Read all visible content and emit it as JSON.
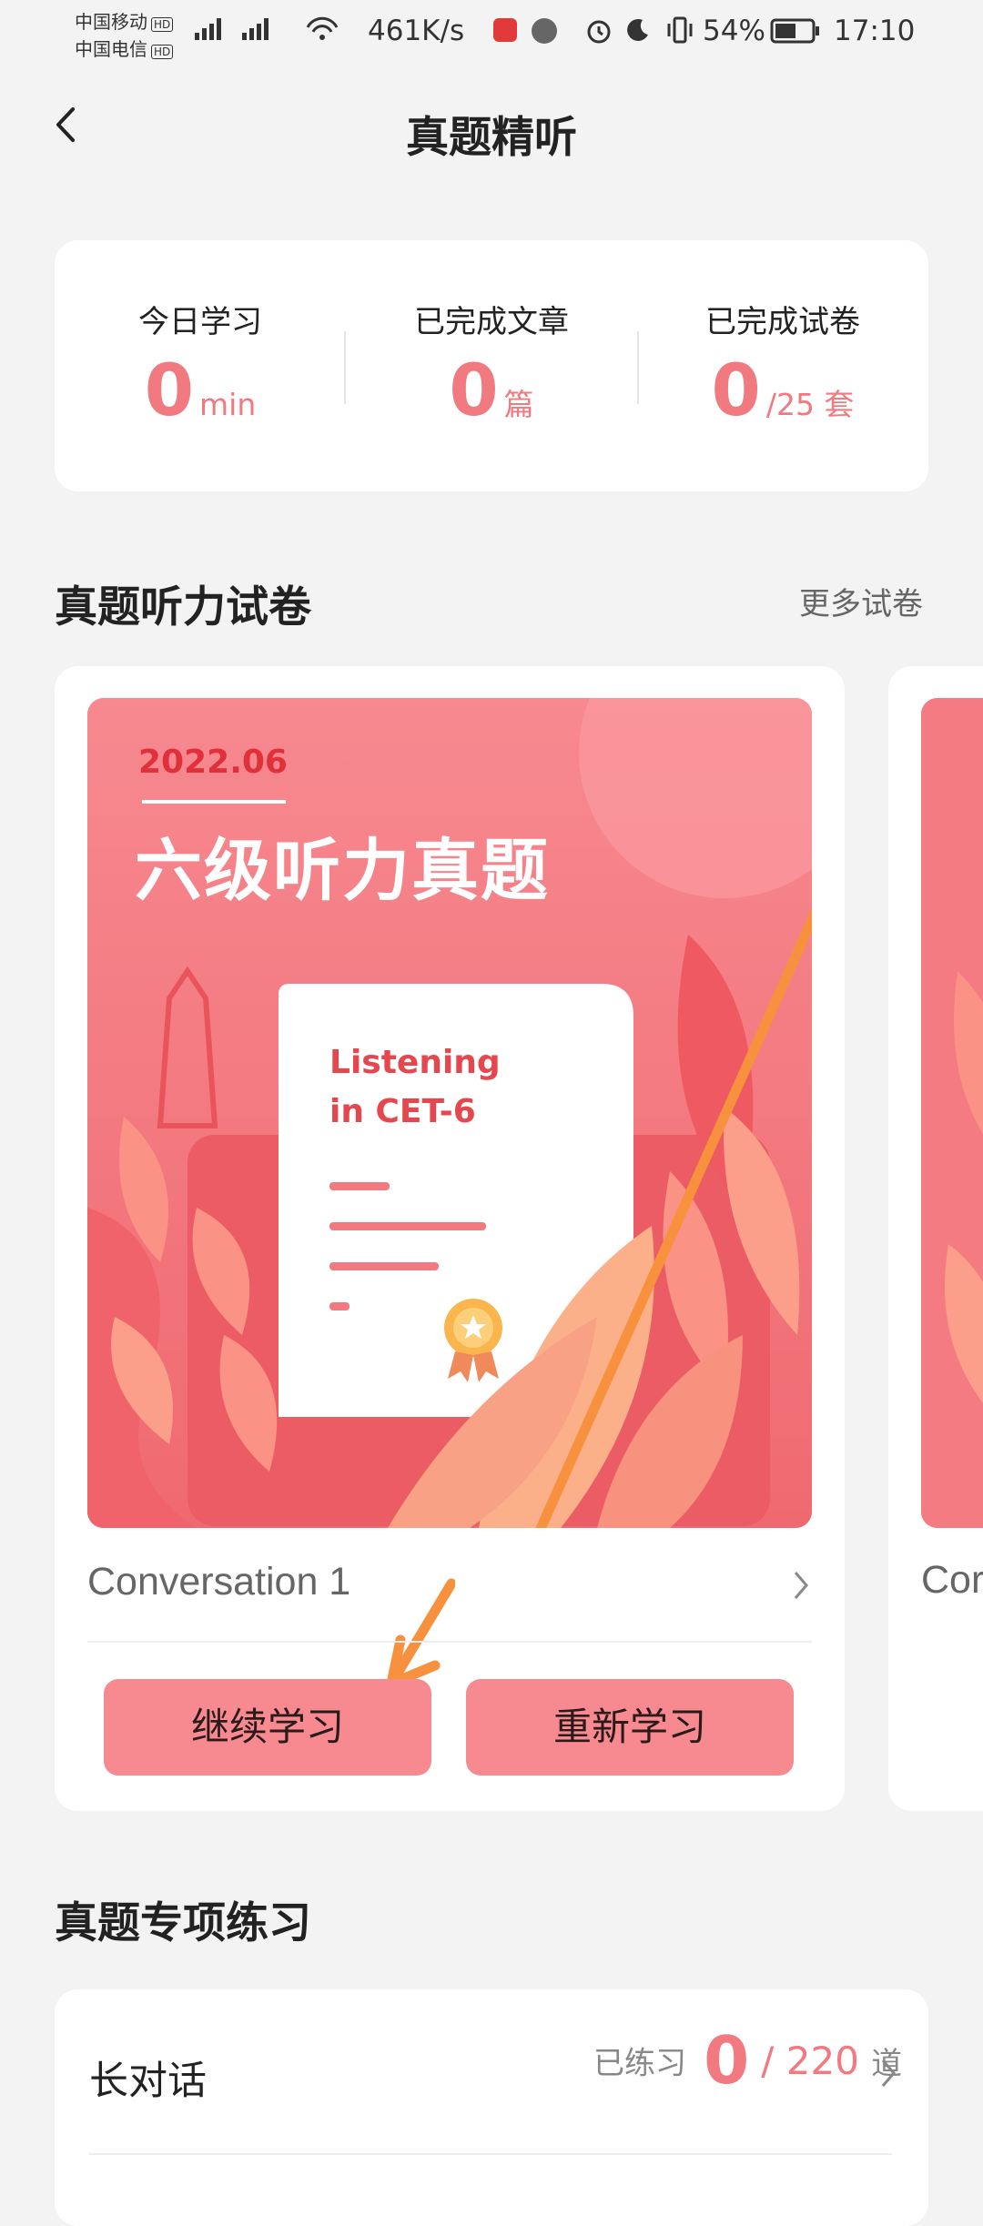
{
  "status_bar": {
    "carrier1": "中国移动",
    "carrier2": "中国电信",
    "hd": "HD",
    "speed": "461K/s",
    "battery": "54%",
    "time": "17:10"
  },
  "header": {
    "title": "真题精听"
  },
  "stats": [
    {
      "label": "今日学习",
      "value": "0",
      "unit": "min"
    },
    {
      "label": "已完成文章",
      "value": "0",
      "unit": "篇"
    },
    {
      "label": "已完成试卷",
      "value": "0",
      "unit": "/25 套"
    }
  ],
  "papers_section": {
    "title": "真题听力试卷",
    "more": "更多试卷"
  },
  "paper": {
    "date": "2022.06",
    "cover_title": "六级听力真题",
    "doc_line1": "Listening",
    "doc_line2": "in CET-6",
    "conversation": "Conversation 1",
    "continue_btn": "继续学习",
    "restart_btn": "重新学习"
  },
  "paper_next": {
    "conversation_partial": "Cor"
  },
  "practice_section": {
    "title": "真题专项练习",
    "items": [
      {
        "label": "长对话",
        "prefix": "已练习",
        "done": "0",
        "total": "/ 220",
        "unit": "道"
      }
    ]
  },
  "colors": {
    "accent": "#f07a80",
    "button": "#f78a90",
    "cover": "#f47b82",
    "arrow": "#f7913d"
  }
}
